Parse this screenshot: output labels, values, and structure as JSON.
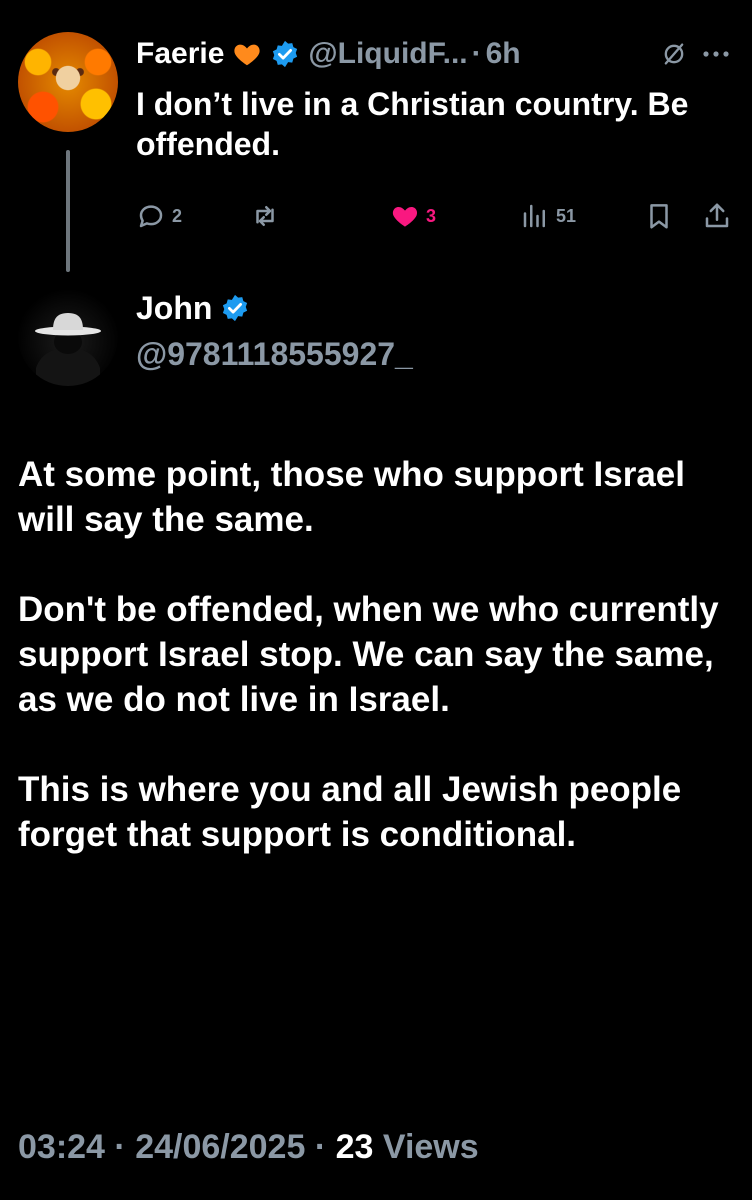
{
  "parent_tweet": {
    "display_name": "Faerie",
    "handle": "@LiquidF...",
    "separator": "·",
    "time": "6h",
    "text": "I don’t live in a Christian country. Be offended.",
    "actions": {
      "replies": "2",
      "likes": "3",
      "views": "51"
    },
    "name_emoji": "orange-heart-icon",
    "verified": true
  },
  "main_tweet": {
    "display_name": "John",
    "handle": "@9781118555927_",
    "verified": true,
    "paragraphs": [
      "At some point, those who support Israel will say the same.",
      "Don't be offended, when we who currently support Israel stop.  We can say the same, as we do not live in Israel.",
      "This is where you and all Jewish people forget that support is conditional."
    ],
    "meta": {
      "time": "03:24",
      "sep1": "·",
      "date": "24/06/2025",
      "sep2": "·",
      "views_count": "23",
      "views_label": "Views"
    }
  },
  "colors": {
    "background": "#000000",
    "text": "#ffffff",
    "secondary": "#8b98a5",
    "like_pink": "#f91880",
    "verified_blue": "#1d9bf0",
    "heart_orange": "#ff8a1c"
  }
}
